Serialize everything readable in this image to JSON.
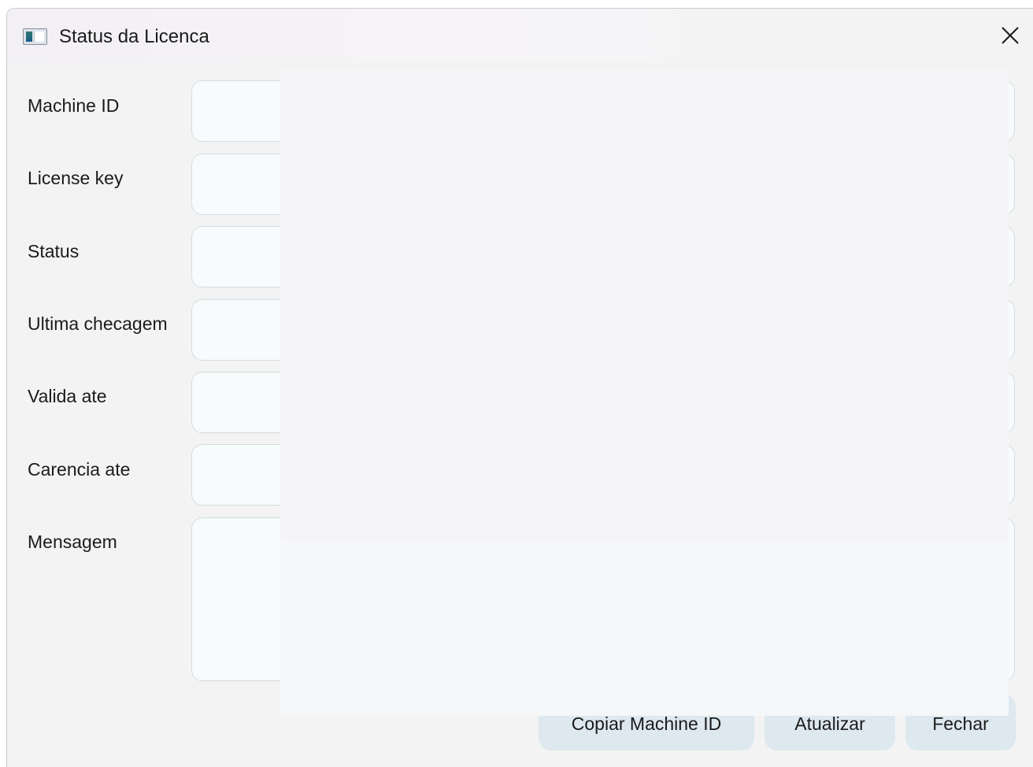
{
  "window": {
    "title": "Status da Licenca",
    "app_icon": "window-app-icon",
    "close_icon": "close-icon"
  },
  "form": {
    "fields": [
      {
        "label": "Machine ID",
        "value": ""
      },
      {
        "label": "License key",
        "value": ""
      },
      {
        "label": "Status",
        "value": ""
      },
      {
        "label": "Ultima checagem",
        "value": ""
      },
      {
        "label": "Valida ate",
        "value": ""
      },
      {
        "label": "Carencia ate",
        "value": ""
      }
    ],
    "message": {
      "label": "Mensagem",
      "value": ""
    }
  },
  "buttons": {
    "copy_machine_id": "Copiar Machine ID",
    "refresh": "Atualizar",
    "close": "Fechar"
  },
  "colors": {
    "window_bg": "#f3f3f3",
    "input_bg": "#f7fbfc",
    "input_border": "#d4dde1",
    "button_bg": "#dde8ef"
  }
}
